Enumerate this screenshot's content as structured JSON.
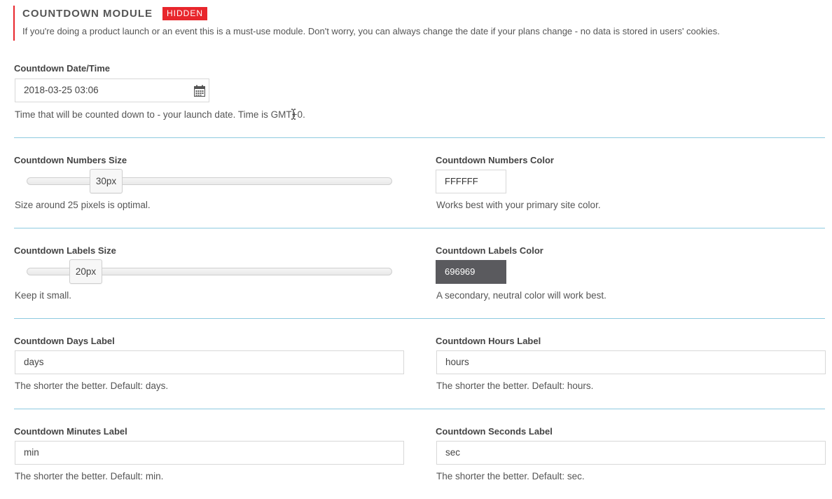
{
  "module": {
    "title": "COUNTDOWN MODULE",
    "badge": "HIDDEN",
    "description": "If you're doing a product launch or an event this is a must-use module. Don't worry, you can always change the date if your plans change - no data is stored in users' cookies.",
    "accent_color": "#e8262c"
  },
  "datetime": {
    "label": "Countdown Date/Time",
    "value": "2018-03-25 03:06",
    "icon": "calendar-icon",
    "help": "Time that will be counted down to - your launch date. Time is GMT+0."
  },
  "numbers_size": {
    "label": "Countdown Numbers Size",
    "value": "30px",
    "help": "Size around 25 pixels is optimal."
  },
  "numbers_color": {
    "label": "Countdown Numbers Color",
    "value": "FFFFFF",
    "swatch": "#ffffff",
    "help": "Works best with your primary site color."
  },
  "labels_size": {
    "label": "Countdown Labels Size",
    "value": "20px",
    "help": "Keep it small."
  },
  "labels_color": {
    "label": "Countdown Labels Color",
    "value": "696969",
    "swatch": "#5a5a5e",
    "help": "A secondary, neutral color will work best."
  },
  "days_label": {
    "label": "Countdown Days Label",
    "value": "days",
    "help": "The shorter the better. Default: days."
  },
  "hours_label": {
    "label": "Countdown Hours Label",
    "value": "hours",
    "help": "The shorter the better. Default: hours."
  },
  "minutes_label": {
    "label": "Countdown Minutes Label",
    "value": "min",
    "help": "The shorter the better. Default: min."
  },
  "seconds_label": {
    "label": "Countdown Seconds Label",
    "value": "sec",
    "help": "The shorter the better. Default: sec."
  }
}
